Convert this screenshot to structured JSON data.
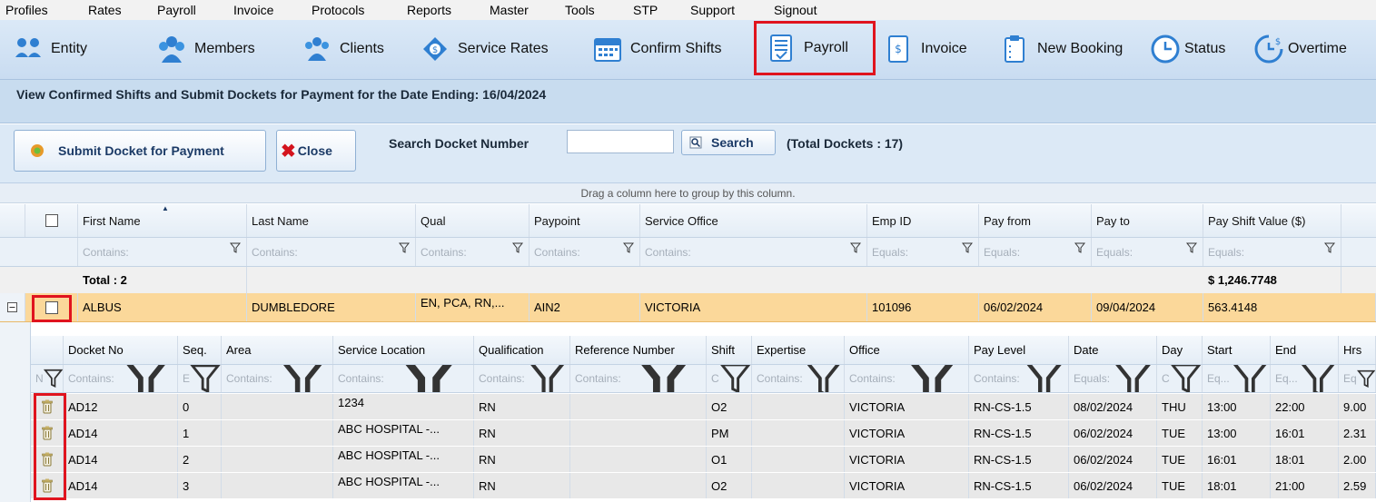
{
  "menu": [
    "Profiles",
    "Rates",
    "Payroll",
    "Invoice",
    "Protocols",
    "Reports",
    "Master",
    "Tools",
    "STP",
    "Support",
    "Signout"
  ],
  "toolbar": {
    "entity": "Entity",
    "members": "Members",
    "clients": "Clients",
    "service_rates": "Service Rates",
    "confirm_shifts": "Confirm Shifts",
    "payroll": "Payroll",
    "invoice": "Invoice",
    "new_booking": "New Booking",
    "status": "Status",
    "overtime": "Overtime"
  },
  "title": "View Confirmed Shifts and Submit Dockets for Payment for the Date Ending: 16/04/2024",
  "actions": {
    "submit": "Submit Docket for Payment",
    "close": "Close",
    "search_label": "Search Docket Number",
    "search_value": "",
    "search_button": "Search",
    "total_dockets": "(Total Dockets : 17)"
  },
  "group_hint": "Drag a column here to group by this column.",
  "grid": {
    "columns": [
      "First Name",
      "Last Name",
      "Qual",
      "Paypoint",
      "Service Office",
      "Emp ID",
      "Pay from",
      "Pay to",
      "Pay Shift Value ($)"
    ],
    "filters": [
      "Contains:",
      "Contains:",
      "Contains:",
      "Contains:",
      "Contains:",
      "Equals:",
      "Equals:",
      "Equals:",
      "Equals:"
    ],
    "total_label": "Total : 2",
    "total_value": "$ 1,246.7748",
    "row": [
      "ALBUS",
      "DUMBLEDORE",
      "EN, PCA, RN,...",
      "AIN2",
      "VICTORIA",
      "101096",
      "06/02/2024",
      "09/04/2024",
      "563.4148"
    ]
  },
  "detail": {
    "columns": [
      "Docket No",
      "Seq.",
      "Area",
      "Service Location",
      "Qualification",
      "Reference Number",
      "Shift",
      "Expertise",
      "Office",
      "Pay Level",
      "Date",
      "Day",
      "Start",
      "End",
      "Hrs"
    ],
    "filters": [
      "N",
      "Contains:",
      "E",
      "Contains:",
      "Contains:",
      "Contains:",
      "Contains:",
      "C",
      "Contains:",
      "Contains:",
      "Contains:",
      "Equals:",
      "C",
      "Eq...",
      "Eq...",
      "Eq"
    ],
    "rows": [
      [
        "AD12",
        "0",
        "",
        "1234",
        "RN",
        "",
        "O2",
        "",
        "VICTORIA",
        "RN-CS-1.5",
        "08/02/2024",
        "THU",
        "13:00",
        "22:00",
        "9.00"
      ],
      [
        "AD14",
        "1",
        "",
        "ABC HOSPITAL -...",
        "RN",
        "",
        "PM",
        "",
        "VICTORIA",
        "RN-CS-1.5",
        "06/02/2024",
        "TUE",
        "13:00",
        "16:01",
        "2.31"
      ],
      [
        "AD14",
        "2",
        "",
        "ABC HOSPITAL -...",
        "RN",
        "",
        "O1",
        "",
        "VICTORIA",
        "RN-CS-1.5",
        "06/02/2024",
        "TUE",
        "16:01",
        "18:01",
        "2.00"
      ],
      [
        "AD14",
        "3",
        "",
        "ABC HOSPITAL -...",
        "RN",
        "",
        "O2",
        "",
        "VICTORIA",
        "RN-CS-1.5",
        "06/02/2024",
        "TUE",
        "18:01",
        "21:00",
        "2.59"
      ]
    ]
  },
  "colors": {
    "highlight": "#e0141e",
    "selected_row": "#fbd89a",
    "toolbar": "#c9dcf1"
  }
}
